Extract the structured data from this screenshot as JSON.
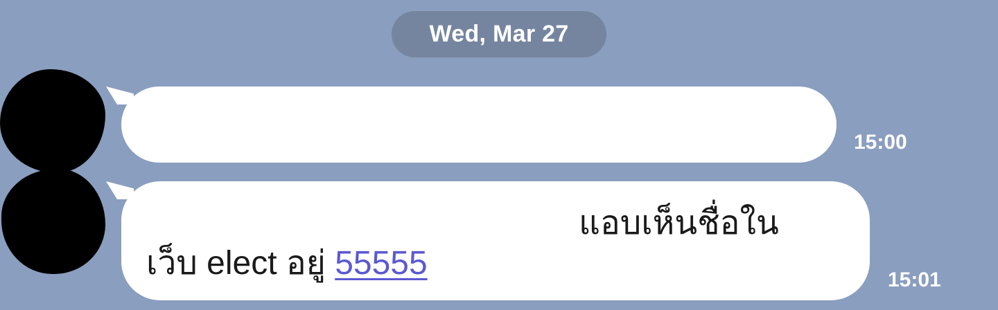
{
  "date_separator": "Wed, Mar 27",
  "messages": [
    {
      "text": "",
      "time": "15:00"
    },
    {
      "line1": "แอบเห็นชื่อใน",
      "line2_prefix": "เว็บ elect อยู่",
      "link_text": "55555",
      "time": "15:01"
    }
  ],
  "colors": {
    "background": "#8a9ebf",
    "date_pill": "#76859f",
    "bubble": "#ffffff",
    "link": "#5b59d1"
  }
}
